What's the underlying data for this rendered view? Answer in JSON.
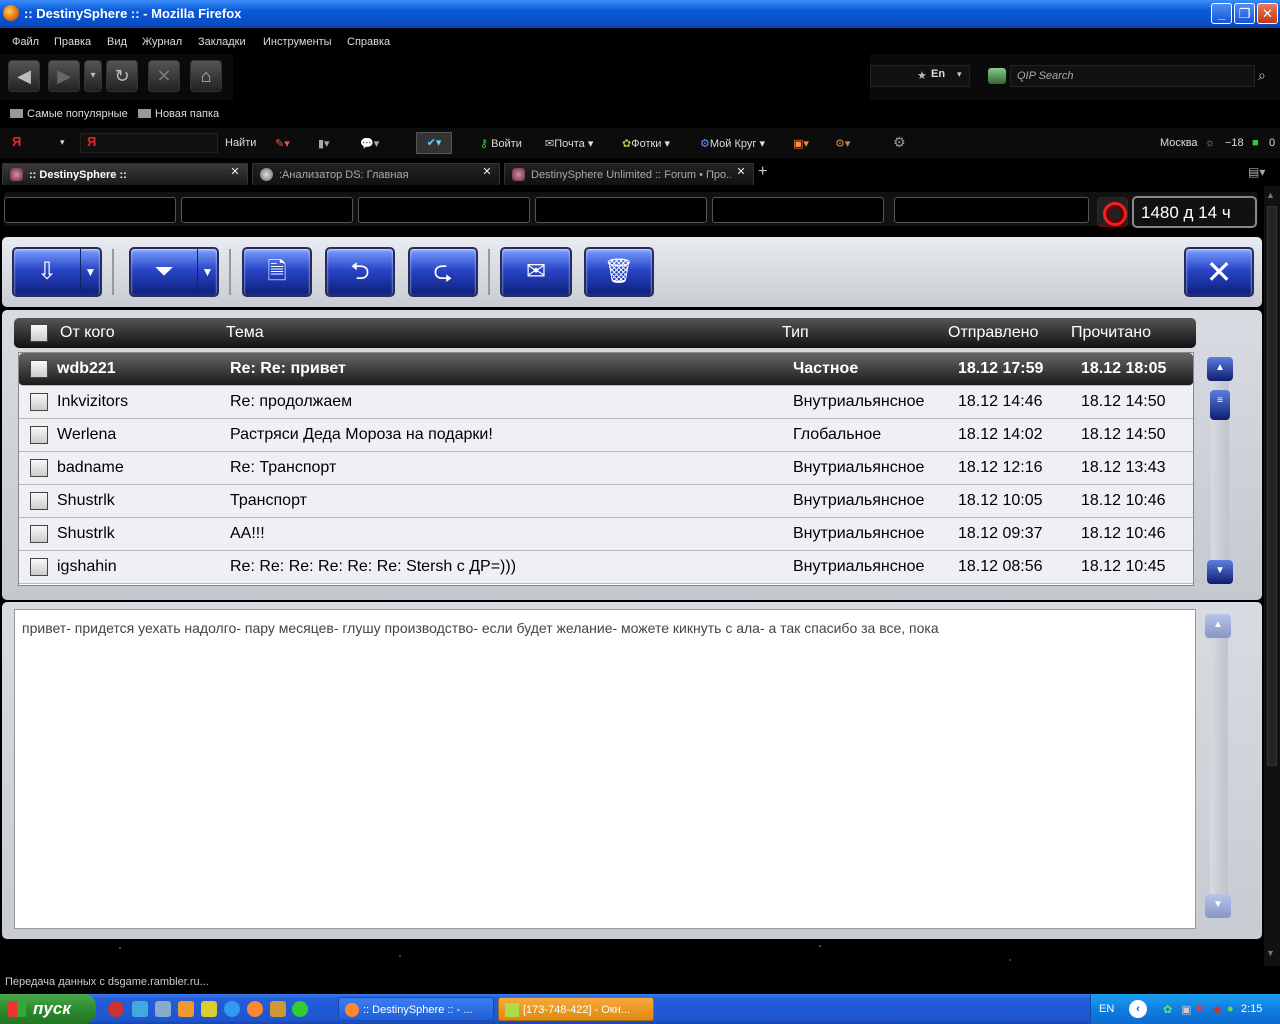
{
  "window": {
    "title": ":: DestinySphere :: - Mozilla Firefox"
  },
  "menu": [
    "Файл",
    "Правка",
    "Вид",
    "Журнал",
    "Закладки",
    "Инструменты",
    "Справка"
  ],
  "nav": {
    "lang": "En",
    "search_placeholder": "QIP Search"
  },
  "bookmarks": [
    "Самые популярные",
    "Новая папка"
  ],
  "yandex": {
    "logo": "Я",
    "find": "Найти",
    "login": "Войти",
    "mail": "Почта",
    "photos": "Фотки",
    "circle": "Мой Круг",
    "city": "Москва",
    "temp": "−18",
    "count": "0"
  },
  "tabs": [
    {
      "label": ":: DestinySphere ::",
      "active": true
    },
    {
      "label": ":Анализатор DS: Главная",
      "active": false
    },
    {
      "label": "DestinySphere Unlimited :: Forum • Про...",
      "active": false
    }
  ],
  "game": {
    "timer": "1480 д 14 ч"
  },
  "messages": {
    "headers": {
      "from": "От кого",
      "subject": "Тема",
      "type": "Тип",
      "sent": "Отправлено",
      "read": "Прочитано"
    },
    "rows": [
      {
        "from": "wdb221",
        "subject": "Re: Re: привет",
        "type": "Частное",
        "sent": "18.12 17:59",
        "read": "18.12 18:05",
        "selected": true
      },
      {
        "from": "Inkvizitors",
        "subject": "Re: продолжаем",
        "type": "Внутриальянсное",
        "sent": "18.12 14:46",
        "read": "18.12 14:50",
        "selected": false
      },
      {
        "from": "Werlena",
        "subject": "Растряси Деда Мороза на подарки!",
        "type": "Глобальное",
        "sent": "18.12 14:02",
        "read": "18.12 14:50",
        "selected": false
      },
      {
        "from": "badname",
        "subject": "Re: Транспорт",
        "type": "Внутриальянсное",
        "sent": "18.12 12:16",
        "read": "18.12 13:43",
        "selected": false
      },
      {
        "from": "Shustrlk",
        "subject": "Транспорт",
        "type": "Внутриальянсное",
        "sent": "18.12 10:05",
        "read": "18.12 10:46",
        "selected": false
      },
      {
        "from": "Shustrlk",
        "subject": "АА!!!",
        "type": "Внутриальянсное",
        "sent": "18.12 09:37",
        "read": "18.12 10:46",
        "selected": false
      },
      {
        "from": "igshahin",
        "subject": "Re: Re: Re: Re: Re: Re: Stersh с ДР=)))",
        "type": "Внутриальянсное",
        "sent": "18.12 08:56",
        "read": "18.12 10:45",
        "selected": false
      }
    ],
    "body": "привет- придется уехать надолго- пару месяцев- глушу производство- если будет желание- можете кикнуть с ала- а так спасибо за все, пока"
  },
  "status": "Передача данных с dsgame.rambler.ru...",
  "taskbar": {
    "start": "пуск",
    "tasks": [
      ":: DestinySphere :: - ...",
      "[173-748-422] - Окн..."
    ],
    "lang": "EN",
    "clock": "2:15"
  },
  "colors": {
    "accent_blue": "#2a46c8",
    "selected_row": "#1a1a1a",
    "taskbar": "#245edb"
  }
}
